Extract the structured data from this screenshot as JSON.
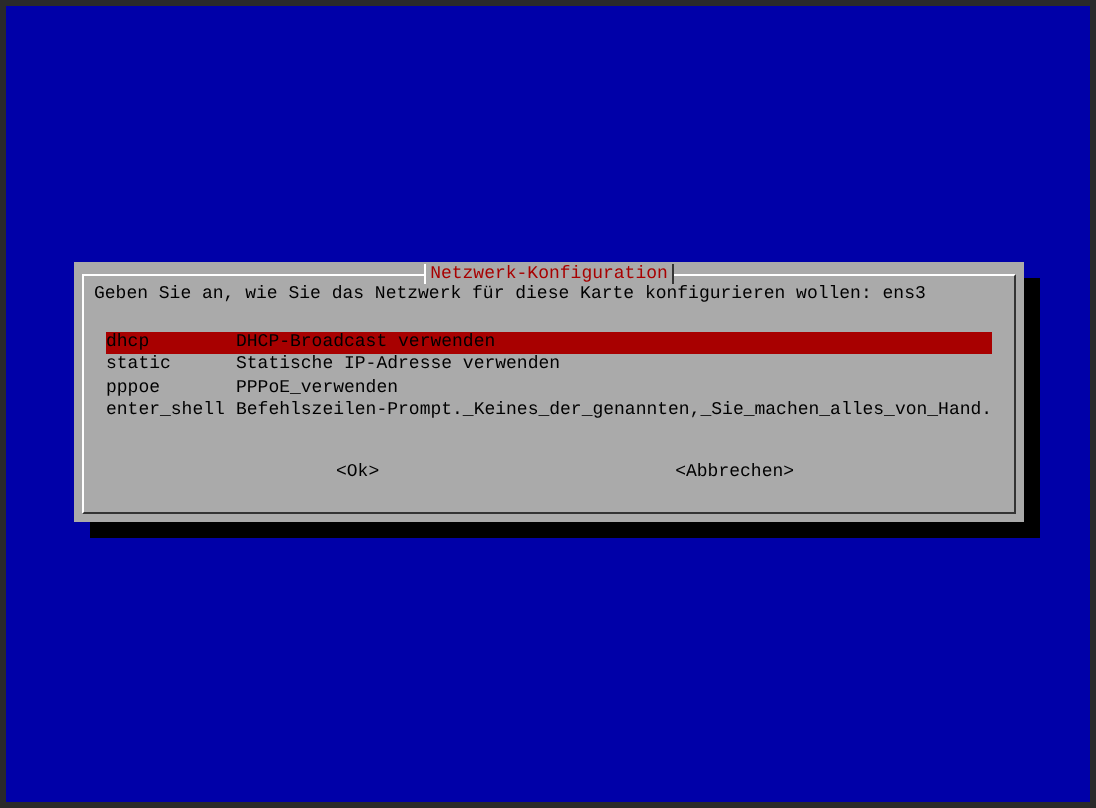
{
  "dialog": {
    "title": "Netzwerk-Konfiguration",
    "prompt": "Geben Sie an, wie Sie das Netzwerk für diese Karte konfigurieren wollen: ens3",
    "options": [
      {
        "name": "dhcp",
        "description": "DHCP-Broadcast verwenden",
        "selected": true
      },
      {
        "name": "static",
        "description": "Statische IP-Adresse verwenden",
        "selected": false
      },
      {
        "name": "pppoe",
        "description": "PPPoE_verwenden",
        "selected": false
      },
      {
        "name": "enter_shell",
        "description": "Befehlszeilen-Prompt._Keines_der_genannten,_Sie_machen_alles_von_Hand.",
        "selected": false
      }
    ],
    "buttons": [
      {
        "label": "<Ok>"
      },
      {
        "label": "<Abbrechen>"
      }
    ]
  }
}
